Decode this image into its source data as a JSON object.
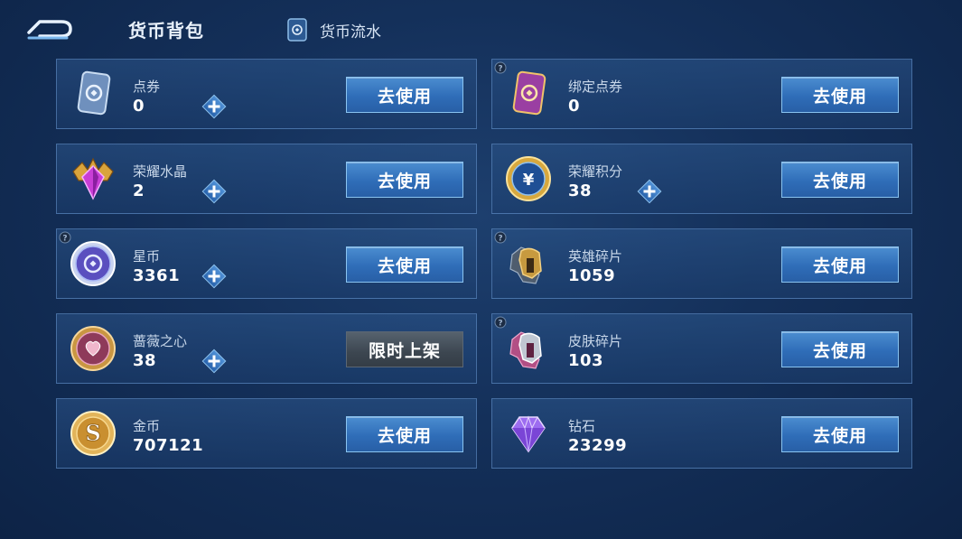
{
  "header": {
    "title": "货币背包",
    "ledger_label": "货币流水"
  },
  "colors": {
    "accent_blue": "#2f6db8",
    "card_border": "#6896ce",
    "disabled_gray": "#3c4650",
    "background": "#14305a"
  },
  "currencies": [
    {
      "name": "点券",
      "amount": "0",
      "icon": "coupon-card-icon",
      "button": "去使用",
      "has_plus": true
    },
    {
      "name": "绑定点券",
      "amount": "0",
      "icon": "bound-coupon-card-icon",
      "button": "去使用",
      "has_plus": false
    },
    {
      "name": "荣耀水晶",
      "amount": "2",
      "icon": "glory-crystal-icon",
      "button": "去使用",
      "has_plus": true
    },
    {
      "name": "荣耀积分",
      "amount": "38",
      "icon": "glory-points-icon",
      "button": "去使用",
      "has_plus": true
    },
    {
      "name": "星币",
      "amount": "3361",
      "icon": "star-coin-icon",
      "button": "去使用",
      "has_plus": true
    },
    {
      "name": "英雄碎片",
      "amount": "1059",
      "icon": "hero-fragment-icon",
      "button": "去使用",
      "has_plus": false
    },
    {
      "name": "蔷薇之心",
      "amount": "38",
      "icon": "rose-heart-icon",
      "button": "限时上架",
      "has_plus": true
    },
    {
      "name": "皮肤碎片",
      "amount": "103",
      "icon": "skin-fragment-icon",
      "button": "去使用",
      "has_plus": false
    },
    {
      "name": "金币",
      "amount": "707121",
      "icon": "gold-coin-icon",
      "button": "去使用",
      "has_plus": false
    },
    {
      "name": "钻石",
      "amount": "23299",
      "icon": "diamond-icon",
      "button": "去使用",
      "has_plus": false
    }
  ]
}
